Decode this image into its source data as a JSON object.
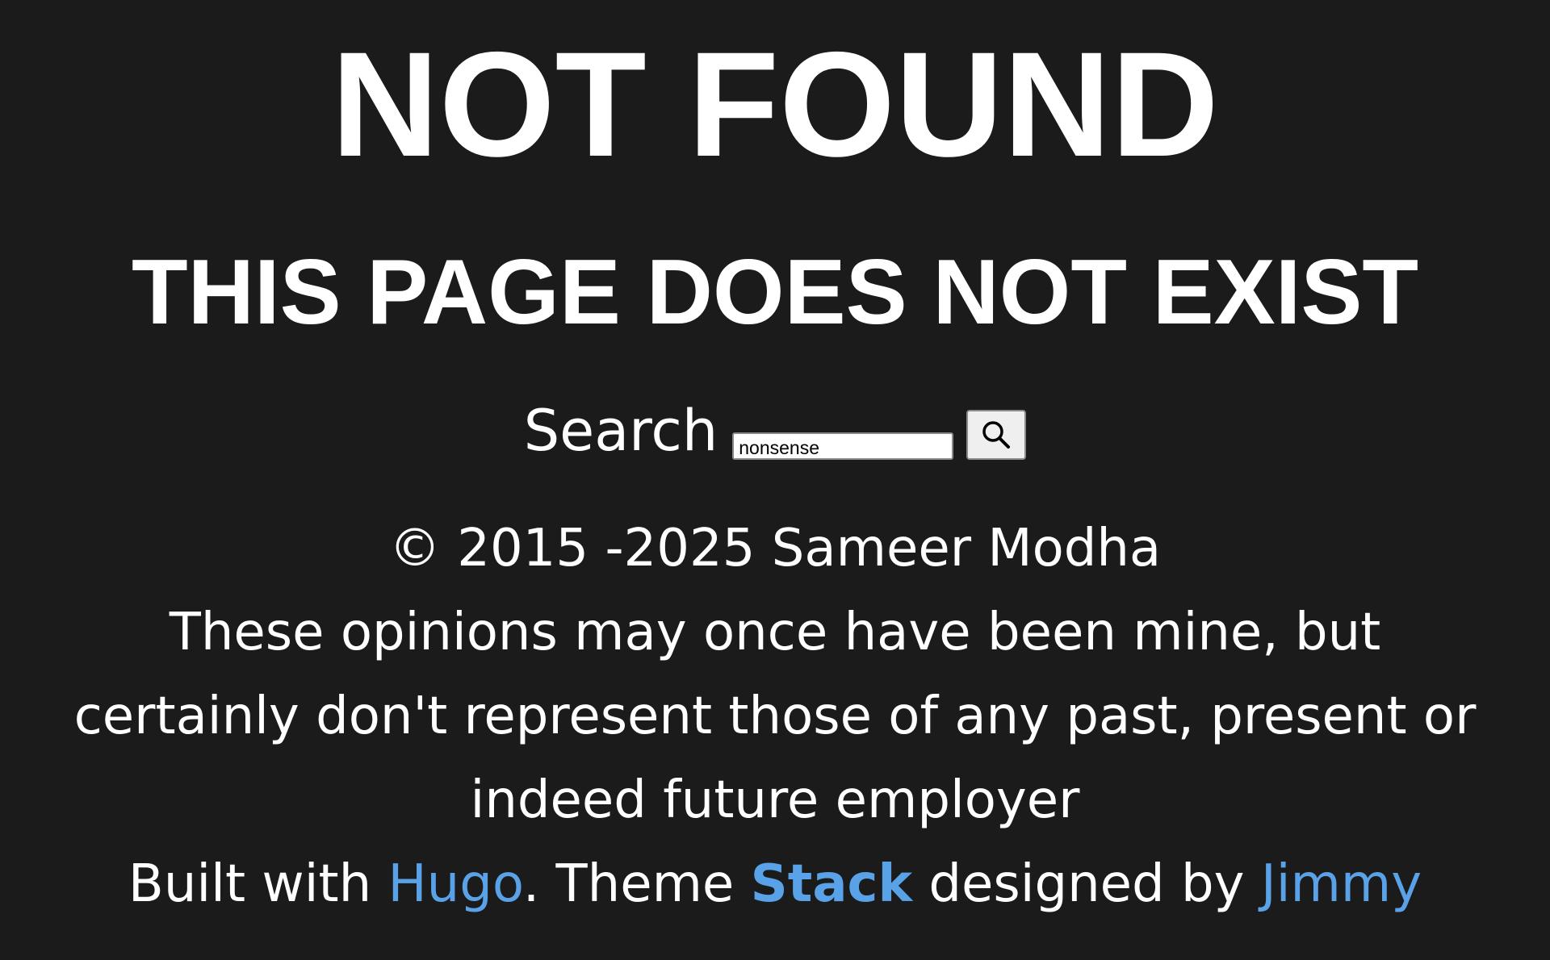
{
  "heading": "NOT FOUND",
  "subheading": "THIS PAGE DOES NOT EXIST",
  "search": {
    "label": "Search",
    "value": "nonsense",
    "button_icon": "search-icon"
  },
  "footer": {
    "copyright": "© 2015 -2025 Sameer Modha",
    "disclaimer": "These opinions may once have been mine, but certainly don't represent those of any past, present or indeed future employer",
    "built_with_prefix": "Built with ",
    "hugo_link": "Hugo",
    "theme_prefix": ". Theme ",
    "stack_link": "Stack",
    "designed_by": " designed by ",
    "jimmy_link": "Jimmy"
  },
  "colors": {
    "background": "#1b1b1b",
    "text": "#ffffff",
    "link": "#5aa2e8"
  }
}
